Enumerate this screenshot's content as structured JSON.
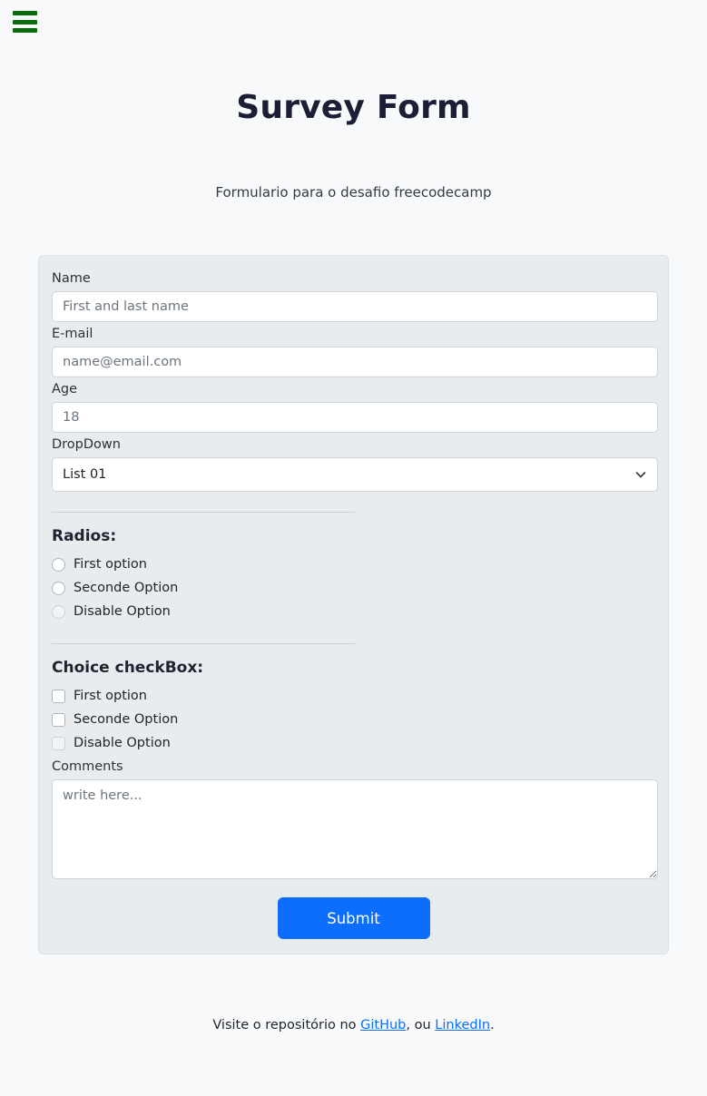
{
  "navbar": {
    "menu_icon": "hamburger-menu-icon"
  },
  "header": {
    "title": "Survey Form",
    "subtitle": "Formulario para o desafio freecodecamp"
  },
  "form": {
    "name": {
      "label": "Name",
      "value": "",
      "placeholder": "First and last name"
    },
    "email": {
      "label": "E-mail",
      "value": "",
      "placeholder": "name@email.com"
    },
    "age": {
      "label": "Age",
      "value": "",
      "placeholder": "18"
    },
    "dropdown": {
      "label": "DropDown",
      "selected": "List 01",
      "options": [
        "List 01"
      ],
      "icon": "chevron-down-icon"
    },
    "radios": {
      "title": "Radios:",
      "options": [
        {
          "label": "First option",
          "checked": false,
          "disabled": false
        },
        {
          "label": "Seconde Option",
          "checked": false,
          "disabled": false
        },
        {
          "label": "Disable Option",
          "checked": false,
          "disabled": true
        }
      ]
    },
    "checkboxes": {
      "title": "Choice checkBox:",
      "options": [
        {
          "label": "First option",
          "checked": false,
          "disabled": false
        },
        {
          "label": "Seconde Option",
          "checked": false,
          "disabled": false
        },
        {
          "label": "Disable Option",
          "checked": false,
          "disabled": true
        }
      ]
    },
    "comments": {
      "label": "Comments",
      "value": "",
      "placeholder": "write here..."
    },
    "submit_label": "Submit"
  },
  "footer": {
    "text_before": "Visite o repositório no ",
    "link_github": "GitHub",
    "text_middle": ", ou ",
    "link_linkedin": "LinkedIn",
    "text_after": "."
  },
  "colors": {
    "page_background": "#f8f9fa",
    "card_background": "#e9ecef",
    "accent_blue": "#0d6efd",
    "menu_green": "#0a6b0a",
    "title_color": "#1a1f36"
  }
}
